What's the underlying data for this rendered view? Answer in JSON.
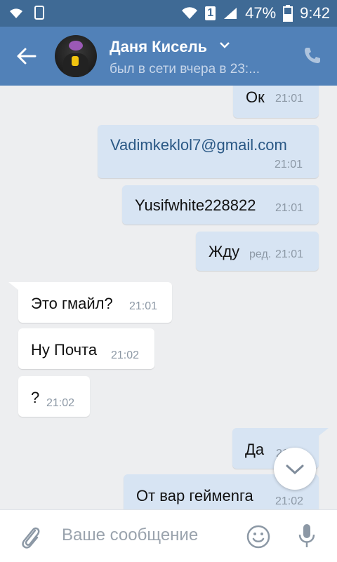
{
  "status_bar": {
    "sim": "1",
    "battery": "47%",
    "time": "9:42"
  },
  "header": {
    "name": "Даня Кисель",
    "status": "был в сети вчера в 23:..."
  },
  "messages": [
    {
      "direction": "out",
      "text": "Ок",
      "time": "21:01"
    },
    {
      "direction": "out",
      "text": "Vadimkeklol7@gmail.com",
      "time": "21:01"
    },
    {
      "direction": "out",
      "text": "Yusifwhite228822",
      "time": "21:01"
    },
    {
      "direction": "out",
      "text": "Жду",
      "edited": "ред.",
      "time": "21:01"
    },
    {
      "direction": "in",
      "text": "Это гмайл?",
      "time": "21:01"
    },
    {
      "direction": "in",
      "text": "Ну Почта",
      "time": "21:02"
    },
    {
      "direction": "in",
      "text": "?",
      "time": "21:02"
    },
    {
      "direction": "out",
      "text": "Да",
      "time": "21:02"
    },
    {
      "direction": "out",
      "text": "От вар геймеnга",
      "time": "21:02"
    }
  ],
  "input": {
    "placeholder": "Ваше сообщение"
  },
  "colors": {
    "statusbar": "#3f6a95",
    "header": "#5181b8",
    "outgoing_bubble": "#d7e4f3",
    "incoming_bubble": "#ffffff",
    "background": "#edeef0"
  }
}
